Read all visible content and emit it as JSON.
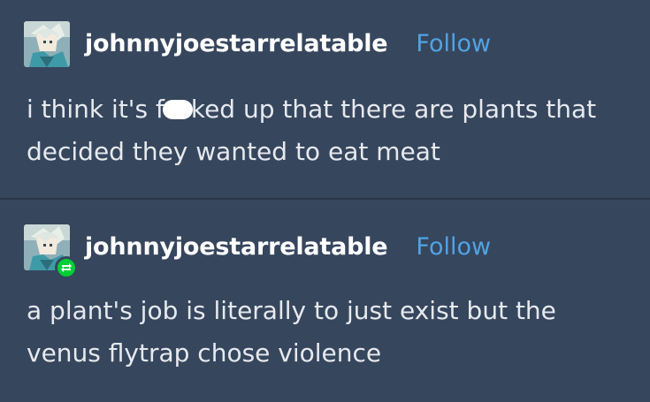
{
  "posts": [
    {
      "username": "johnnyjoestarrelatable",
      "follow_label": "Follow",
      "text_before_redaction": "i think it's f",
      "text_after_redaction": "ked up that there are plants that decided they wanted to eat meat",
      "avatar": "avatar-icon"
    },
    {
      "username": "johnnyjoestarrelatable",
      "follow_label": "Follow",
      "text": "a plant's job is literally to just exist but the venus flytrap chose violence",
      "avatar": "avatar-icon",
      "badge": "reblog-icon"
    }
  ],
  "colors": {
    "background": "#36465d",
    "link": "#52a3e3",
    "reblog_badge": "#00cf35"
  }
}
